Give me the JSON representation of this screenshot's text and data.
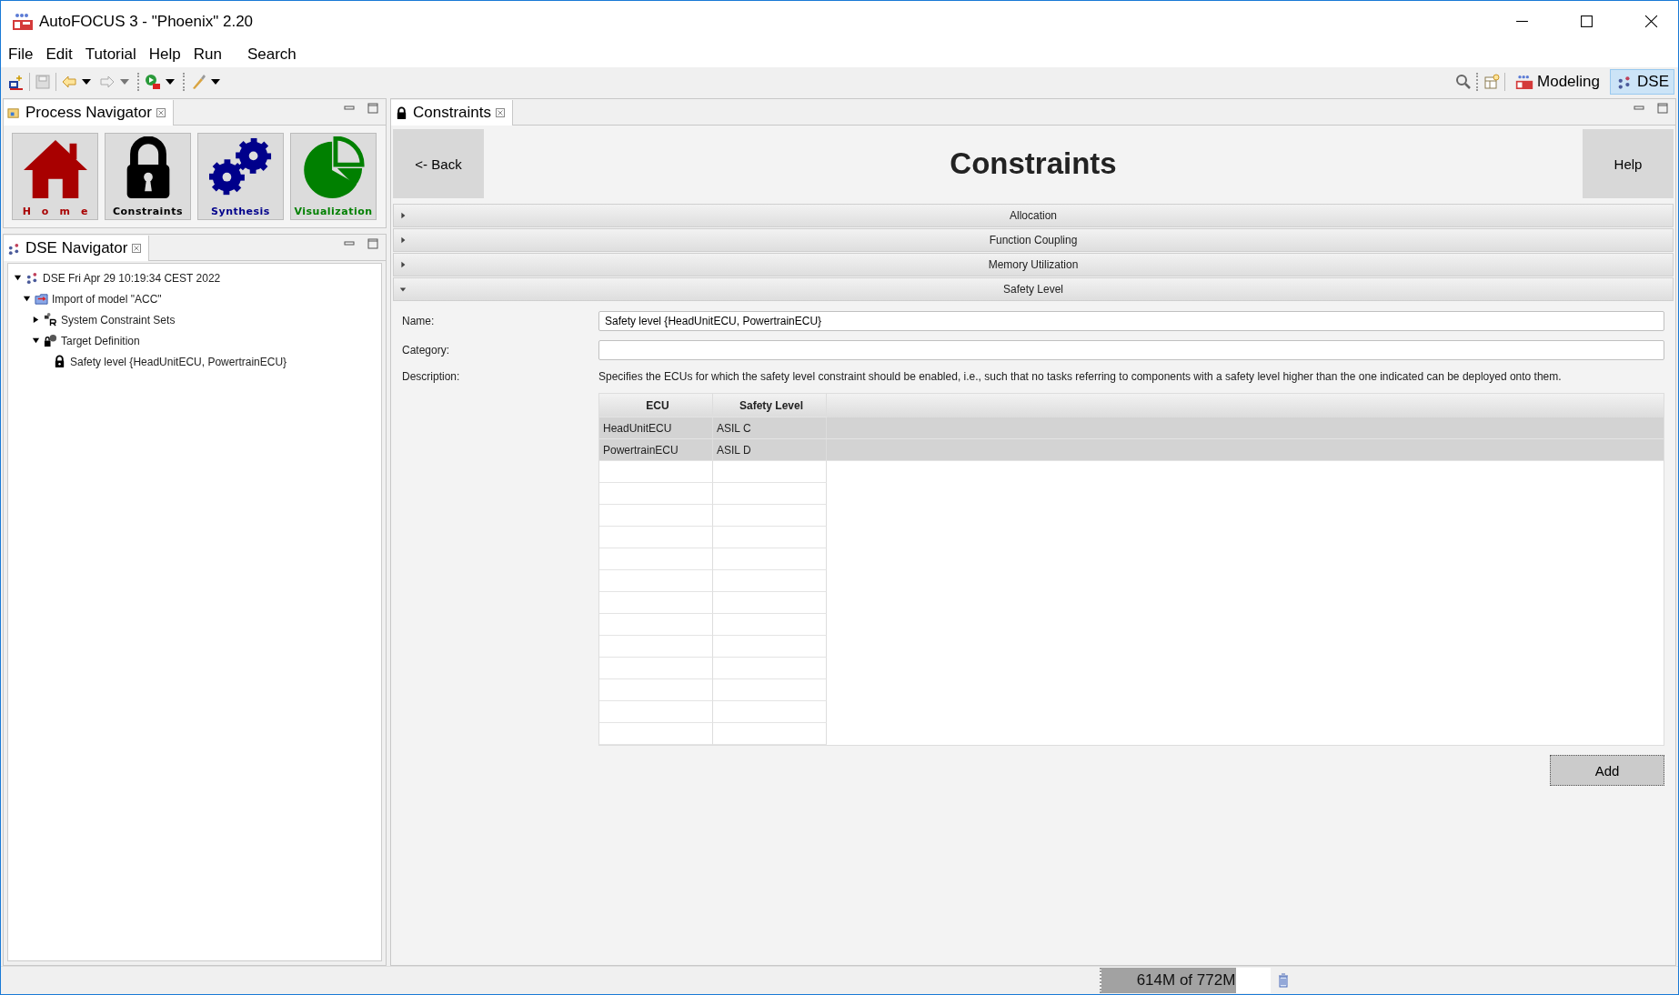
{
  "window": {
    "title": "AutoFOCUS 3 - \"Phoenix\" 2.20"
  },
  "menu": [
    "File",
    "Edit",
    "Tutorial",
    "Help",
    "Run",
    "Search"
  ],
  "perspectives": [
    {
      "label": "Modeling",
      "selected": false,
      "kind": "af3"
    },
    {
      "label": "DSE",
      "selected": true,
      "kind": "dse"
    }
  ],
  "process_navigator": {
    "title": "Process Navigator",
    "items": [
      {
        "label": "Home",
        "kind": "home",
        "color": "#a80000"
      },
      {
        "label": "Constraints",
        "kind": "lock",
        "color": "#000000"
      },
      {
        "label": "Synthesis",
        "kind": "gears",
        "color": "#00008b"
      },
      {
        "label": "Visualization",
        "kind": "pie",
        "color": "#008000"
      }
    ]
  },
  "dse_navigator": {
    "title": "DSE Navigator",
    "tree": [
      {
        "label": "DSE Fri Apr 29 10:19:34 CEST 2022",
        "kind": "dse",
        "expanded": true,
        "children": [
          {
            "label": "Import of model \"ACC\"",
            "kind": "import",
            "expanded": true,
            "children": [
              {
                "label": "System Constraint Sets",
                "kind": "constraints",
                "expanded": false
              },
              {
                "label": "Target Definition",
                "kind": "target",
                "expanded": true,
                "children": [
                  {
                    "label": "Safety level {HeadUnitECU, PowertrainECU}",
                    "kind": "lock"
                  }
                ]
              }
            ]
          }
        ]
      }
    ]
  },
  "editor": {
    "tab": "Constraints",
    "back": "<- Back",
    "title": "Constraints",
    "help": "Help",
    "sections": [
      {
        "label": "Allocation",
        "expanded": false
      },
      {
        "label": "Function Coupling",
        "expanded": false
      },
      {
        "label": "Memory Utilization",
        "expanded": false
      },
      {
        "label": "Safety Level",
        "expanded": true
      }
    ],
    "form": {
      "name_label": "Name:",
      "name_value": "Safety level {HeadUnitECU, PowertrainECU}",
      "category_label": "Category:",
      "description_label": "Description:",
      "description": "Specifies the ECUs for which the safety level constraint should be enabled, i.e., such that no tasks referring to components with a safety level higher than the one indicated can be deployed onto them."
    },
    "table": {
      "columns": [
        "ECU",
        "Safety Level"
      ],
      "rows": [
        [
          "HeadUnitECU",
          "ASIL C"
        ],
        [
          "PowertrainECU",
          "ASIL D"
        ]
      ]
    },
    "add": "Add"
  },
  "status_bar": {
    "memory": "614M of 772M",
    "level": 0.795
  }
}
